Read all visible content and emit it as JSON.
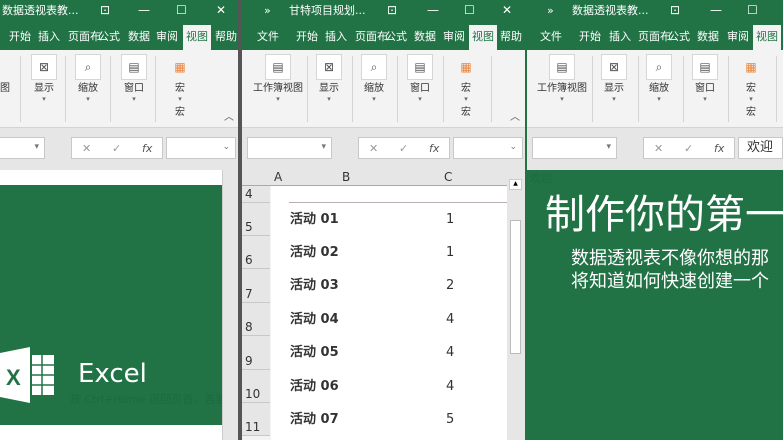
{
  "left": {
    "title": "数据透视表教...",
    "tabs": [
      "开始",
      "插入",
      "页面布",
      "公式",
      "数据",
      "审阅",
      "视图",
      "帮助"
    ],
    "groups": [
      "视图",
      "显示",
      "缩放",
      "窗口",
      "宏"
    ],
    "macro_group": "宏",
    "logo_text": "Excel",
    "faint_text": "按 Ctrl+Home 返回页首，若要开始"
  },
  "middle": {
    "title": "甘特项目规划...",
    "tabs": [
      "文件",
      "开始",
      "插入",
      "页面布",
      "公式",
      "数据",
      "审阅",
      "视图",
      "帮助"
    ],
    "groups": [
      "工作簿视图",
      "显示",
      "缩放",
      "窗口",
      "宏"
    ],
    "macro_group": "宏",
    "columns": [
      "A",
      "B",
      "C"
    ],
    "rows": [
      {
        "n": "4",
        "b": "",
        "c": ""
      },
      {
        "n": "5",
        "b": "活动 01",
        "c": "1"
      },
      {
        "n": "6",
        "b": "活动 02",
        "c": "1"
      },
      {
        "n": "7",
        "b": "活动 03",
        "c": "2"
      },
      {
        "n": "8",
        "b": "活动 04",
        "c": "4"
      },
      {
        "n": "9",
        "b": "活动 05",
        "c": "4"
      },
      {
        "n": "10",
        "b": "活动 06",
        "c": "4"
      },
      {
        "n": "11",
        "b": "活动 07",
        "c": "5"
      }
    ]
  },
  "right": {
    "title": "数据透视表教...",
    "tabs": [
      "文件",
      "开始",
      "插入",
      "页面布",
      "公式",
      "数据",
      "审阅",
      "视图"
    ],
    "groups": [
      "工作簿视图",
      "显示",
      "缩放",
      "窗口",
      "宏"
    ],
    "macro_group": "宏",
    "formula_value": "欢迎",
    "cell_label": "欢迎",
    "heading": "制作你的第一个",
    "line1": "数据透视表不像你想的那",
    "line2": "将知道如何快速创建一个"
  },
  "icons": {
    "cancel": "✕",
    "enter": "✓",
    "fx": "fx",
    "collapse": "︿"
  }
}
